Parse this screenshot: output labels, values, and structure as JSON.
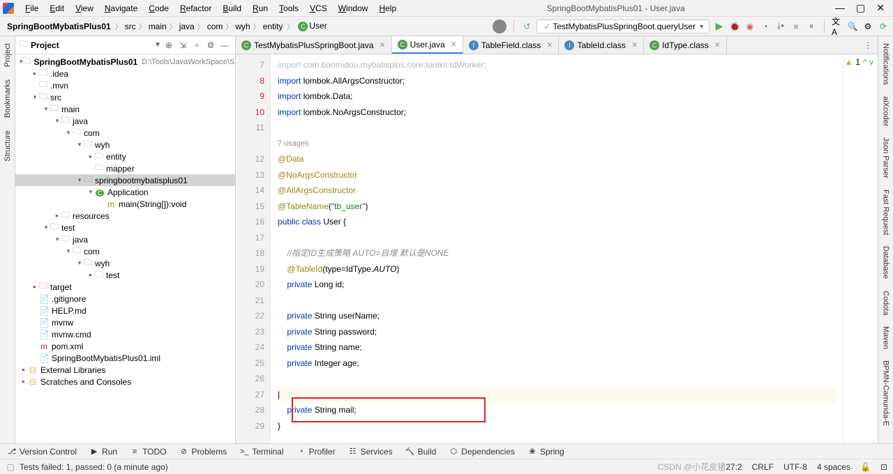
{
  "window": {
    "title": "SpringBootMybatisPlus01 - User.java",
    "menu": [
      "File",
      "Edit",
      "View",
      "Navigate",
      "Code",
      "Refactor",
      "Build",
      "Run",
      "Tools",
      "VCS",
      "Window",
      "Help"
    ]
  },
  "breadcrumb": {
    "root": "SpringBootMybatisPlus01",
    "parts": [
      "src",
      "main",
      "java",
      "com",
      "wyh",
      "entity"
    ],
    "cls": "User"
  },
  "run_config": "TestMybatisPlusSpringBoot.queryUser",
  "project_panel": {
    "title": "Project"
  },
  "tree": {
    "root": {
      "name": "SpringBootMybatisPlus01",
      "path": "D:\\Tools\\JavaWorkSpace\\Sprin"
    },
    "items": [
      {
        "indent": 1,
        "arrow": ">",
        "icon": "folder",
        "label": ".idea"
      },
      {
        "indent": 1,
        "arrow": "",
        "icon": "folder",
        "label": ".mvn"
      },
      {
        "indent": 1,
        "arrow": "v",
        "icon": "folder-src",
        "label": "src"
      },
      {
        "indent": 2,
        "arrow": "v",
        "icon": "folder-src",
        "label": "main"
      },
      {
        "indent": 3,
        "arrow": "v",
        "icon": "folder-src",
        "label": "java"
      },
      {
        "indent": 4,
        "arrow": "v",
        "icon": "folder",
        "label": "com"
      },
      {
        "indent": 5,
        "arrow": "v",
        "icon": "folder",
        "label": "wyh"
      },
      {
        "indent": 6,
        "arrow": ">",
        "icon": "folder",
        "label": "entity"
      },
      {
        "indent": 6,
        "arrow": "",
        "icon": "folder",
        "label": "mapper"
      },
      {
        "indent": 5,
        "arrow": "v",
        "icon": "folder",
        "label": "springbootmybatisplus01",
        "selected": true
      },
      {
        "indent": 6,
        "arrow": "v",
        "icon": "class",
        "label": "Application"
      },
      {
        "indent": 7,
        "arrow": "",
        "icon": "method",
        "label": "main(String[]):void"
      },
      {
        "indent": 3,
        "arrow": ">",
        "icon": "folder",
        "label": "resources"
      },
      {
        "indent": 2,
        "arrow": "v",
        "icon": "folder",
        "label": "test"
      },
      {
        "indent": 3,
        "arrow": "v",
        "icon": "folder",
        "label": "java"
      },
      {
        "indent": 4,
        "arrow": "v",
        "icon": "folder",
        "label": "com"
      },
      {
        "indent": 5,
        "arrow": "v",
        "icon": "folder",
        "label": "wyh"
      },
      {
        "indent": 6,
        "arrow": ">",
        "icon": "folder",
        "label": "test"
      },
      {
        "indent": 1,
        "arrow": ">",
        "icon": "folder-ex",
        "label": "target"
      },
      {
        "indent": 1,
        "arrow": "",
        "icon": "file",
        "label": ".gitignore"
      },
      {
        "indent": 1,
        "arrow": "",
        "icon": "file",
        "label": "HELP.md"
      },
      {
        "indent": 1,
        "arrow": "",
        "icon": "file",
        "label": "mvnw"
      },
      {
        "indent": 1,
        "arrow": "",
        "icon": "file",
        "label": "mvnw.cmd"
      },
      {
        "indent": 1,
        "arrow": "",
        "icon": "file-m",
        "label": "pom.xml"
      },
      {
        "indent": 1,
        "arrow": "",
        "icon": "file",
        "label": "SpringBootMybatisPlus01.iml"
      }
    ],
    "externals": "External Libraries",
    "scratches": "Scratches and Consoles"
  },
  "tabs": [
    {
      "label": "TestMybatisPlusSpringBoot.java",
      "icon": "fi-class"
    },
    {
      "label": "User.java",
      "icon": "fi-class",
      "active": true
    },
    {
      "label": "TableField.class",
      "icon": "fi-interface"
    },
    {
      "label": "TableId.class",
      "icon": "fi-interface"
    },
    {
      "label": "IdType.class",
      "icon": "fi-class"
    }
  ],
  "code": {
    "first_line_num": 7,
    "err_lines": [
      8,
      9,
      10
    ],
    "lines": [
      {
        "html": "<span class='kw'>import</span> com.baomidou.mybatisplus.core.toolkit.IdWorker;",
        "faded": true
      },
      {
        "html": "<span class='kw'>import</span> <span class='imp-pkg'>lombok.</span>AllArgsConstructor;"
      },
      {
        "html": "<span class='kw'>import</span> <span class='imp-pkg'>lombok.</span>Data;"
      },
      {
        "html": "<span class='kw'>import</span> <span class='imp-pkg'>lombok.</span>NoArgsConstructor;"
      },
      {
        "html": ""
      },
      {
        "blank_with_usages": true,
        "usages": "7 usages"
      },
      {
        "html": "<span class='ann'>@Data</span>"
      },
      {
        "html": "<span class='ann'>@NoArgsConstructor</span>"
      },
      {
        "html": "<span class='ann'>@AllArgsConstructor</span>"
      },
      {
        "html": "<span class='ann'>@TableName</span>(<span class='str'>\"tb_user\"</span>)"
      },
      {
        "html": "<span class='kw'>public class</span> User {"
      },
      {
        "html": ""
      },
      {
        "html": "    <span class='cmt'>//指定ID生成策略 AUTO=自增 默认是NONE</span>"
      },
      {
        "html": "    <span class='ann'>@TableId</span>(type=IdType.<span style='font-style:italic'>AUTO</span>)"
      },
      {
        "html": "    <span class='kw'>private</span> Long id;"
      },
      {
        "html": ""
      },
      {
        "html": "    <span class='kw'>private</span> String userName;"
      },
      {
        "html": "    <span class='kw'>private</span> String password;"
      },
      {
        "html": "    <span class='kw'>private</span> String name;"
      },
      {
        "html": "    <span class='kw'>private</span> Integer age;"
      },
      {
        "html": ""
      },
      {
        "html": "|",
        "cursor": true
      },
      {
        "html": "    <span class='kw'>private</span> String mail;"
      },
      {
        "html": "}"
      }
    ]
  },
  "minimap": {
    "warn": "1",
    "ok": "^ v"
  },
  "left_tabs": [
    "Project",
    "Bookmarks",
    "Structure"
  ],
  "right_tabs": [
    "Notifications",
    "aiXcoder",
    "Json Parser",
    "Fast Request",
    "Database",
    "Codota",
    "Maven",
    "BPMN-Camunda-E"
  ],
  "bottom_tools": [
    {
      "icon": "⎇",
      "label": "Version Control"
    },
    {
      "icon": "▶",
      "label": "Run"
    },
    {
      "icon": "≡",
      "label": "TODO"
    },
    {
      "icon": "⊘",
      "label": "Problems"
    },
    {
      "icon": ">_",
      "label": "Terminal"
    },
    {
      "icon": "◔",
      "label": "Profiler"
    },
    {
      "icon": "☷",
      "label": "Services"
    },
    {
      "icon": "🔨",
      "label": "Build"
    },
    {
      "icon": "⬡",
      "label": "Dependencies"
    },
    {
      "icon": "❀",
      "label": "Spring"
    }
  ],
  "status": {
    "msg": "Tests failed: 1, passed: 0 (a minute ago)",
    "watermark": "CSDN @小花皮猪",
    "pos": "27:2",
    "eol": "CRLF",
    "enc": "UTF-8",
    "indent": "4 spaces"
  }
}
